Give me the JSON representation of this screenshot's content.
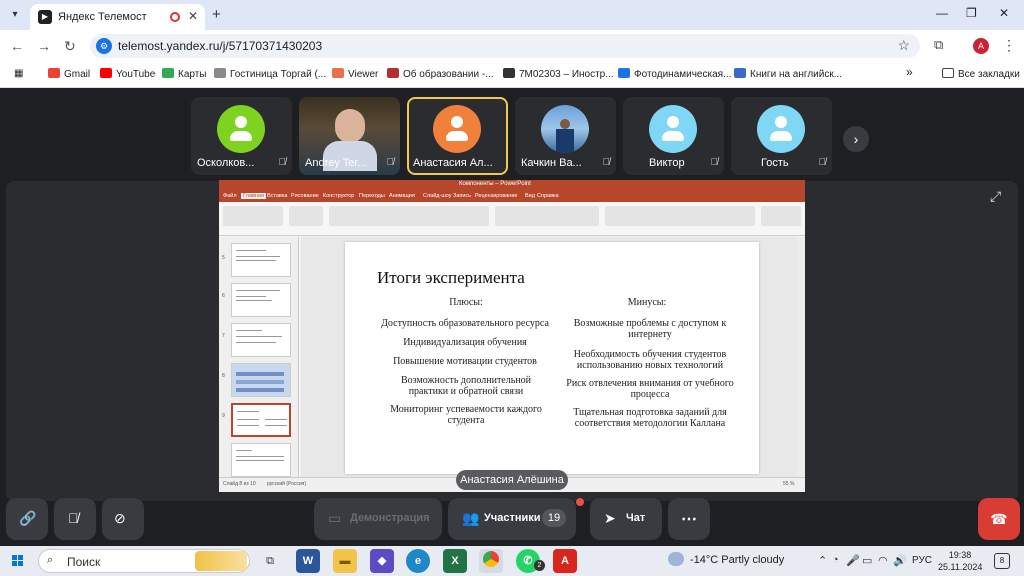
{
  "browser": {
    "tab_title": "Яндекс Телемост",
    "tab_icon": "telemost-icon",
    "url": "telemost.yandex.ru/j/57170371430203",
    "profile_initial": "A",
    "bookmarks": [
      {
        "label": "Gmail",
        "icon": "gmail-icon",
        "color": "#ea4335"
      },
      {
        "label": "YouTube",
        "icon": "youtube-icon",
        "color": "#ff0000"
      },
      {
        "label": "Карты",
        "icon": "maps-icon",
        "color": "#34a853"
      },
      {
        "label": "Гостиница Торгай (...",
        "icon": "hotel-icon",
        "color": "#8a8a8a"
      },
      {
        "label": "Viewer",
        "icon": "viewer-icon",
        "color": "#e8704a"
      },
      {
        "label": "Об образовании -...",
        "icon": "edu-icon",
        "color": "#b43030"
      },
      {
        "label": "7M02303 – Иностр...",
        "icon": "page-icon",
        "color": "#333333"
      },
      {
        "label": "Фотодинамическая...",
        "icon": "plus-icon",
        "color": "#1a73e8"
      },
      {
        "label": "Книги на английск...",
        "icon": "book-icon",
        "color": "#3a6ac8"
      }
    ],
    "more_bookmarks": "»",
    "all_bookmarks": "Все закладки"
  },
  "participants": [
    {
      "name": "Осколков...",
      "avatar_color": "#7ed321",
      "type": "avatar",
      "muted": true
    },
    {
      "name": "Andrey Ter...",
      "type": "video",
      "muted": true
    },
    {
      "name": "Анастасия Ал...",
      "avatar_color": "#f0803c",
      "type": "avatar",
      "active": true,
      "muted": false
    },
    {
      "name": "Качкин Ва...",
      "type": "photo",
      "muted": true
    },
    {
      "name": "Виктор",
      "avatar_color": "#7fd6f5",
      "type": "avatar",
      "muted": true
    },
    {
      "name": "Гость",
      "avatar_color": "#7fd6f5",
      "type": "avatar",
      "muted": true
    }
  ],
  "presentation": {
    "window_title": "Компоненты – PowerPoint",
    "menus": [
      "Файл",
      "Главная",
      "Вставка",
      "Рисование",
      "Конструктор",
      "Переходы",
      "Анимация",
      "Слайд-шоу",
      "Запись",
      "Рецензирование",
      "Вид",
      "Справка"
    ],
    "selected_menu": "Главная",
    "thumb_numbers": [
      "5",
      "6",
      "7",
      "8",
      "9"
    ],
    "status_left": "Слайд 8 из 10",
    "status_lang": "русский (Россия)",
    "status_zoom": "55 %",
    "slide": {
      "title": "Итоги эксперимента",
      "pros_header": "Плюсы:",
      "cons_header": "Минусы:",
      "pros": [
        "Доступность образовательного ресурса",
        "Индивидуализация обучения",
        "Повышение мотивации студентов",
        "Возможность дополнительной практики и обратной связи",
        "Мониторинг успеваемости каждого студента"
      ],
      "cons": [
        "Возможные проблемы с доступом к интернету",
        "Необходимость обучения студентов использованию новых технологий",
        "Риск отвлечения внимания от учебного процесса",
        "Тщательная подготовка заданий для соответствия методологии Каллана"
      ]
    }
  },
  "speaker_label": "Анастасия Алёшина",
  "controls": {
    "share_label": "Демонстрация",
    "participants_label": "Участники",
    "participants_count": "19",
    "chat_label": "Чат",
    "more_label": "⋯"
  },
  "taskbar": {
    "search_placeholder": "Поиск",
    "weather": "-14°C  Partly cloudy",
    "language": "РУС",
    "time": "19:38",
    "date": "25.11.2024",
    "whatsapp_badge": "2",
    "notifications": "8"
  }
}
